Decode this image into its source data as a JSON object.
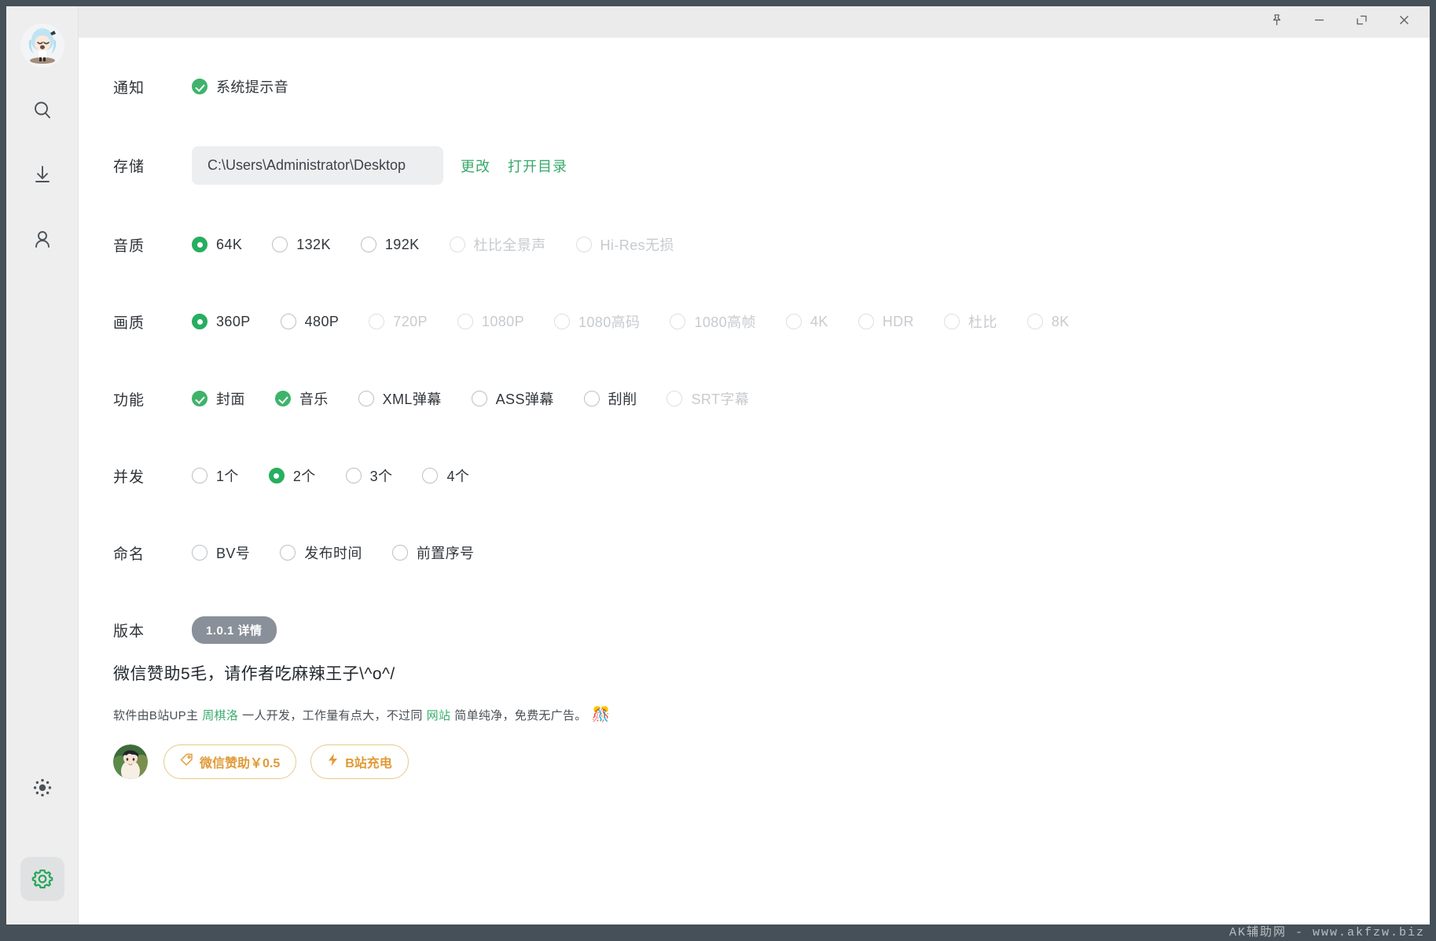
{
  "window": {
    "controls": [
      {
        "name": "pin",
        "icon": "pin-icon",
        "label": "置顶"
      },
      {
        "name": "minimize",
        "icon": "minimize-icon",
        "label": "最小化"
      },
      {
        "name": "maximize",
        "icon": "maximize-icon",
        "label": "最大化"
      },
      {
        "name": "close",
        "icon": "close-icon",
        "label": "关闭"
      }
    ]
  },
  "sidebar": {
    "avatar_alt": "app-avatar",
    "items": [
      {
        "name": "search",
        "icon": "search-icon",
        "label": "搜索",
        "active": false
      },
      {
        "name": "download",
        "icon": "download-icon",
        "label": "下载",
        "active": false
      },
      {
        "name": "user",
        "icon": "user-icon",
        "label": "我的",
        "active": false
      }
    ],
    "bottom_items": [
      {
        "name": "theme",
        "icon": "brightness-icon",
        "label": "主题",
        "active": false
      },
      {
        "name": "settings",
        "icon": "gear-icon",
        "label": "设置",
        "active": true
      }
    ]
  },
  "settings": {
    "notification": {
      "label": "通知",
      "options": [
        {
          "label": "系统提示音",
          "type": "checkbox",
          "checked": true,
          "disabled": false
        }
      ]
    },
    "storage": {
      "label": "存储",
      "path": "C:\\Users\\Administrator\\Desktop",
      "change_label": "更改",
      "open_dir_label": "打开目录"
    },
    "audio_quality": {
      "label": "音质",
      "options": [
        {
          "label": "64K",
          "checked": true,
          "disabled": false
        },
        {
          "label": "132K",
          "checked": false,
          "disabled": false
        },
        {
          "label": "192K",
          "checked": false,
          "disabled": false
        },
        {
          "label": "杜比全景声",
          "checked": false,
          "disabled": true
        },
        {
          "label": "Hi-Res无损",
          "checked": false,
          "disabled": true
        }
      ]
    },
    "video_quality": {
      "label": "画质",
      "options": [
        {
          "label": "360P",
          "checked": true,
          "disabled": false
        },
        {
          "label": "480P",
          "checked": false,
          "disabled": false
        },
        {
          "label": "720P",
          "checked": false,
          "disabled": true
        },
        {
          "label": "1080P",
          "checked": false,
          "disabled": true
        },
        {
          "label": "1080高码",
          "checked": false,
          "disabled": true
        },
        {
          "label": "1080高帧",
          "checked": false,
          "disabled": true
        },
        {
          "label": "4K",
          "checked": false,
          "disabled": true
        },
        {
          "label": "HDR",
          "checked": false,
          "disabled": true
        },
        {
          "label": "杜比",
          "checked": false,
          "disabled": true
        },
        {
          "label": "8K",
          "checked": false,
          "disabled": true
        }
      ]
    },
    "features": {
      "label": "功能",
      "options": [
        {
          "label": "封面",
          "type": "checkbox",
          "checked": true,
          "disabled": false
        },
        {
          "label": "音乐",
          "type": "checkbox",
          "checked": true,
          "disabled": false
        },
        {
          "label": "XML弹幕",
          "type": "checkbox",
          "checked": false,
          "disabled": false
        },
        {
          "label": "ASS弹幕",
          "type": "checkbox",
          "checked": false,
          "disabled": false
        },
        {
          "label": "刮削",
          "type": "checkbox",
          "checked": false,
          "disabled": false
        },
        {
          "label": "SRT字幕",
          "type": "checkbox",
          "checked": false,
          "disabled": true
        }
      ]
    },
    "concurrency": {
      "label": "并发",
      "options": [
        {
          "label": "1个",
          "checked": false,
          "disabled": false
        },
        {
          "label": "2个",
          "checked": true,
          "disabled": false
        },
        {
          "label": "3个",
          "checked": false,
          "disabled": false
        },
        {
          "label": "4个",
          "checked": false,
          "disabled": false
        }
      ]
    },
    "naming": {
      "label": "命名",
      "options": [
        {
          "label": "BV号",
          "checked": false,
          "disabled": false
        },
        {
          "label": "发布时间",
          "checked": false,
          "disabled": false
        },
        {
          "label": "前置序号",
          "checked": false,
          "disabled": false
        }
      ]
    },
    "version": {
      "label": "版本",
      "badge": "1.0.1 详情"
    }
  },
  "sponsor": {
    "title": "微信赞助5毛，请作者吃麻辣王子\\^o^/",
    "desc_part1": "软件由B站UP主",
    "desc_link1": "周棋洛",
    "desc_part2": "一人开发，工作量有点大，不过同",
    "desc_link2": "网站",
    "desc_part3": "简单纯净，免费无广告。",
    "desc_emoji": "🎊",
    "buttons": [
      {
        "name": "wechat-donate",
        "icon": "tag-icon",
        "label": "微信赞助￥0.5"
      },
      {
        "name": "bilibili-charge",
        "icon": "lightning-icon",
        "label": "B站充电"
      }
    ]
  },
  "watermark": "AK辅助网 - www.akfzw.biz",
  "colors": {
    "accent_green": "#27ae60",
    "link_green": "#36a96a",
    "gold": "#e09a36",
    "frame": "#455058",
    "sidebar_bg": "#eeeeee",
    "titlebar_bg": "#ebebeb"
  }
}
